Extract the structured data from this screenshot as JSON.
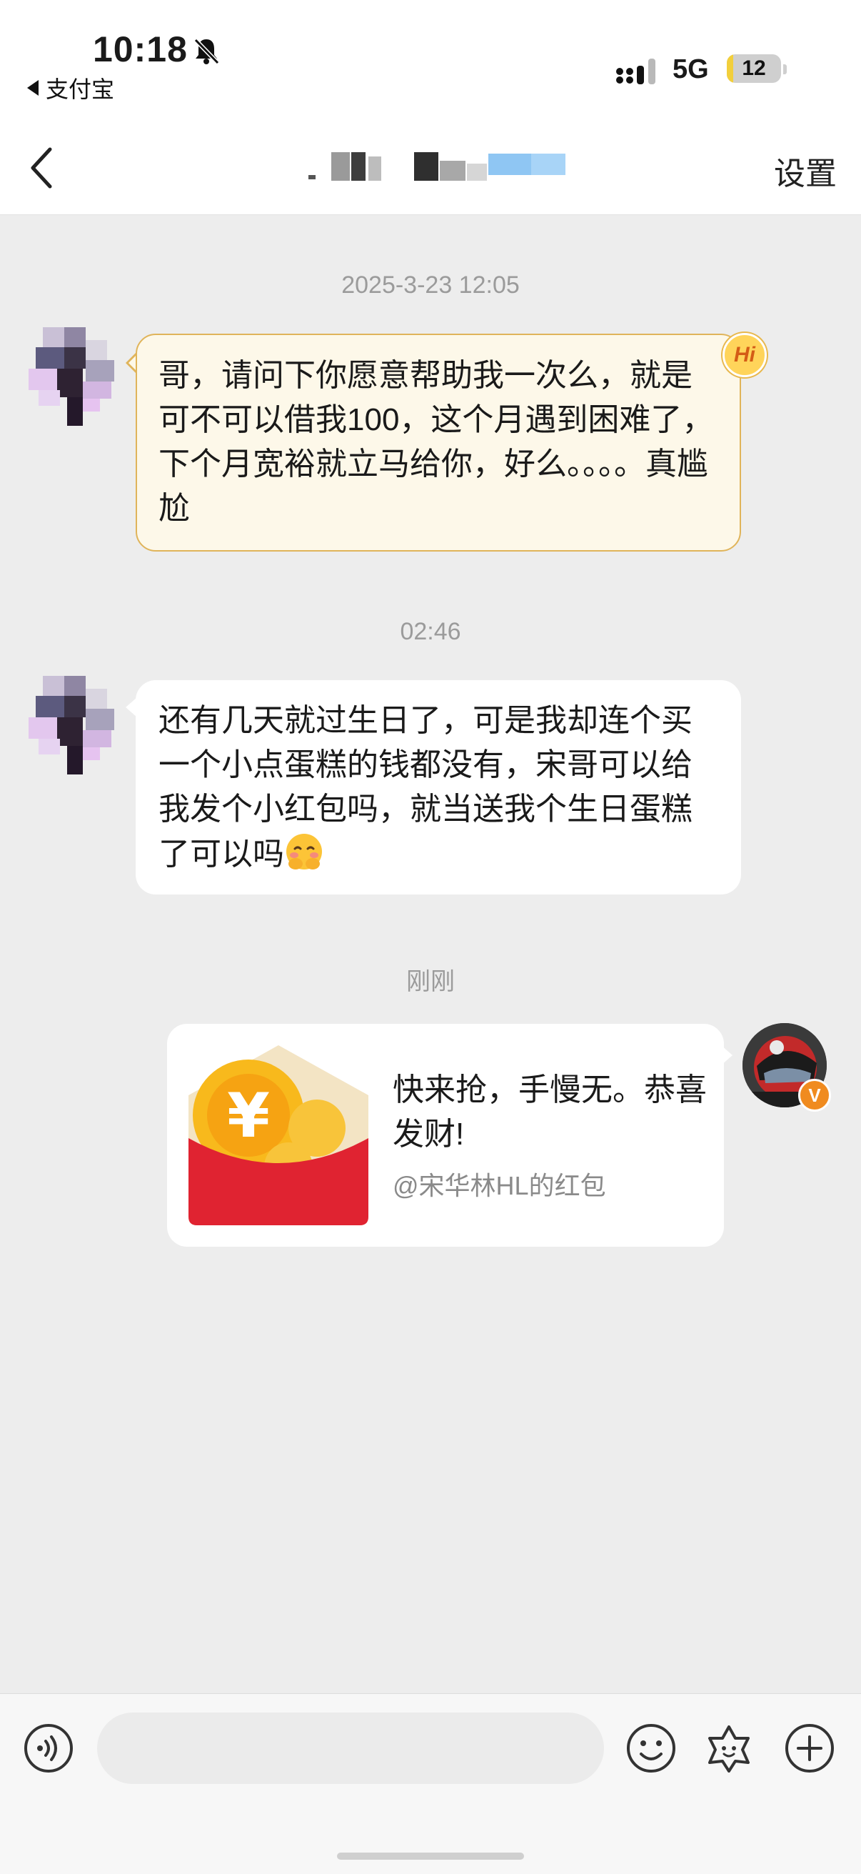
{
  "status_bar": {
    "time": "10:18",
    "back_app": "支付宝",
    "network": "5G",
    "battery": "12",
    "battery_level_percent": 12,
    "icons": [
      "bell-muted-icon",
      "signal-icon"
    ]
  },
  "nav": {
    "back_icon": "chevron-left-icon",
    "title": "",
    "settings_label": "设置"
  },
  "messages": [
    {
      "timestamp": "2025-3-23 12:05",
      "sender": "other",
      "text": "哥，请问下你愿意帮助我一次么，就是可不可以借我100，这个月遇到困难了，下个月宽裕就立马给你，好么。。。。真尴尬",
      "badge": "Hi"
    },
    {
      "timestamp": "02:46",
      "sender": "other",
      "text": "还有几天就过生日了，可是我却连个买一个小点蛋糕的钱都没有，宋哥可以给我发个小红包吗，就当送我个生日蛋糕了可以吗",
      "emoji": "shy-face-emoji"
    },
    {
      "timestamp": "刚刚",
      "sender": "me",
      "type": "red_packet",
      "title": "快来抢，手慢无。恭喜发财!",
      "source": "@宋华林HL的红包",
      "badge": "V"
    }
  ],
  "input_bar": {
    "placeholder": "",
    "icons": [
      "voice-icon",
      "emoji-icon",
      "sticker-icon",
      "plus-icon"
    ]
  },
  "colors": {
    "background": "#ededed",
    "highlight_bubble": "#fdf8e9",
    "highlight_border": "#e0b45a",
    "red_packet": "#e02331",
    "coin": "#f6b51a"
  }
}
